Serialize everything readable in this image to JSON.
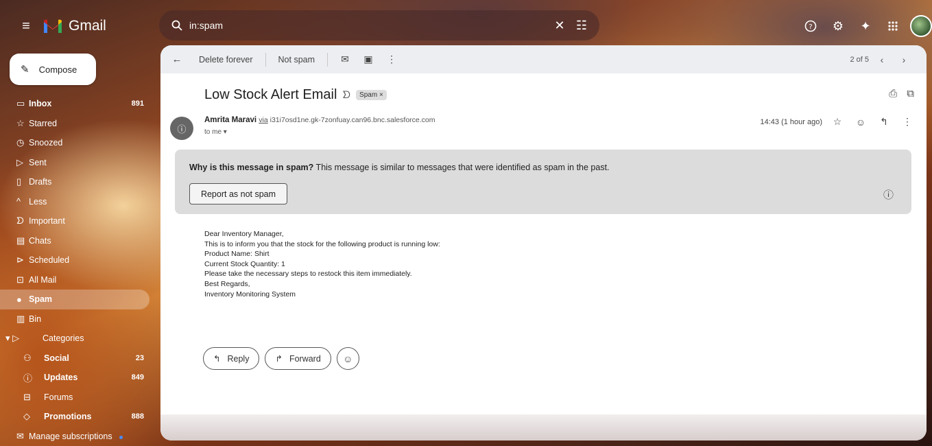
{
  "app": {
    "name": "Gmail"
  },
  "search": {
    "value": "in:spam"
  },
  "sidebar": {
    "compose_label": "Compose",
    "items": [
      {
        "label": "Inbox",
        "count": "891",
        "bold": true,
        "icon": "inbox-icon"
      },
      {
        "label": "Starred",
        "count": "",
        "icon": "star-icon"
      },
      {
        "label": "Snoozed",
        "count": "",
        "icon": "clock-icon"
      },
      {
        "label": "Sent",
        "count": "",
        "icon": "send-icon"
      },
      {
        "label": "Drafts",
        "count": "",
        "icon": "draft-icon"
      },
      {
        "label": "Less",
        "count": "",
        "icon": "chevron-up-icon"
      },
      {
        "label": "Important",
        "count": "",
        "icon": "important-icon"
      },
      {
        "label": "Chats",
        "count": "",
        "icon": "chat-icon"
      },
      {
        "label": "Scheduled",
        "count": "",
        "icon": "scheduled-icon"
      },
      {
        "label": "All Mail",
        "count": "",
        "icon": "all-mail-icon"
      },
      {
        "label": "Spam",
        "count": "",
        "active": true,
        "icon": "spam-icon"
      },
      {
        "label": "Bin",
        "count": "",
        "icon": "bin-icon"
      },
      {
        "label": "Categories",
        "count": "",
        "icon": "label-icon"
      },
      {
        "label": "Social",
        "count": "23",
        "bold": true,
        "icon": "people-icon"
      },
      {
        "label": "Updates",
        "count": "849",
        "bold": true,
        "icon": "info-icon"
      },
      {
        "label": "Forums",
        "count": "",
        "icon": "forum-icon"
      },
      {
        "label": "Promotions",
        "count": "888",
        "bold": true,
        "icon": "tag-icon"
      },
      {
        "label": "Manage subscriptions",
        "count": "",
        "icon": "subscriptions-icon"
      }
    ]
  },
  "toolbar": {
    "delete_label": "Delete forever",
    "not_spam_label": "Not spam",
    "pagination": "2 of 5"
  },
  "message": {
    "subject": "Low Stock Alert Email",
    "label_chip": "Spam ×",
    "sender_name": "Amrita Maravi",
    "via_label": "via",
    "via_domain": "i31i7osd1ne.gk-7zonfuay.can96.bnc.salesforce.com",
    "to_label": "to me ▾",
    "time": "14:43 (1 hour ago)",
    "spam_why_bold": "Why is this message in spam?",
    "spam_why_text": " This message is similar to messages that were identified as spam in the past.",
    "report_label": "Report as not spam",
    "body_lines": [
      "Dear Inventory Manager,",
      "This is to inform you that the stock for the following product is running low:",
      "Product Name: Shirt",
      "Current Stock Quantity: 1",
      "Please take the necessary steps to restock this item immediately.",
      "Best Regards,",
      "Inventory Monitoring System"
    ],
    "reply_label": "Reply",
    "forward_label": "Forward"
  }
}
